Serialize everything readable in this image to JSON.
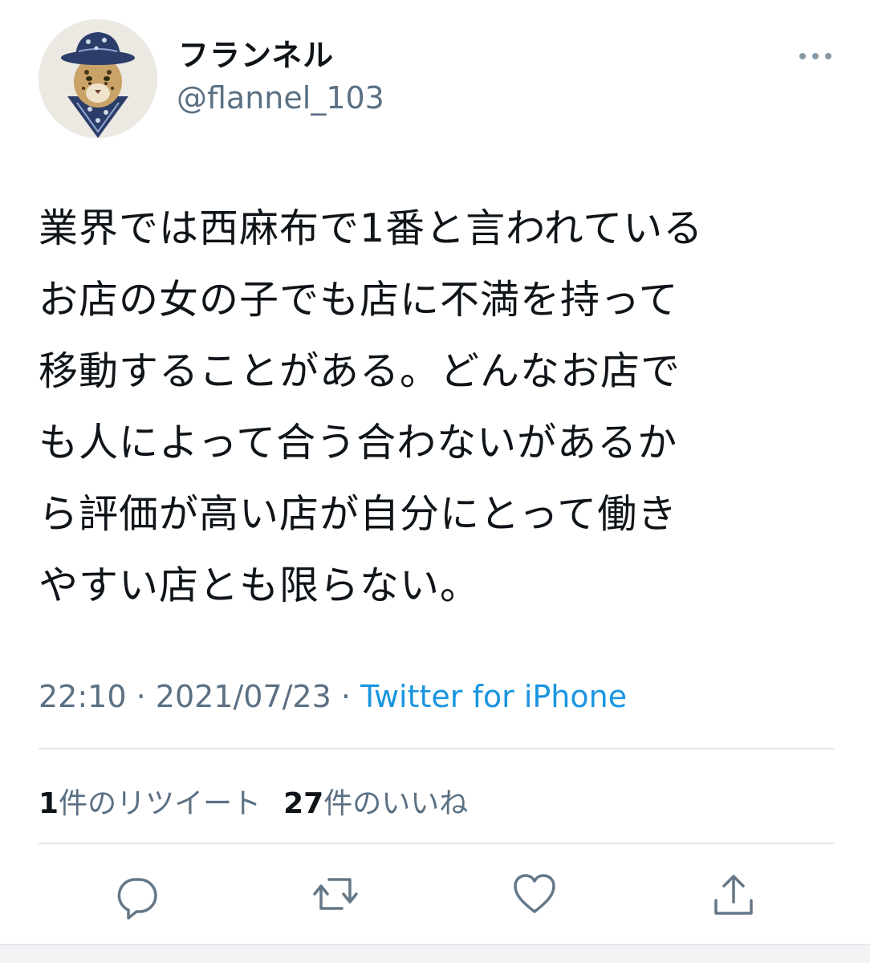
{
  "user": {
    "display_name": "フランネル",
    "handle": "@flannel_103",
    "avatar_icon": "leopard-avatar-icon"
  },
  "tweet": {
    "lines": [
      "業界では西麻布で1番と言われている",
      "お店の女の子でも店に不満を持って",
      "移動することがある。どんなお店で",
      "も人によって合う合わないがあるか",
      "ら評価が高い店が自分にとって働き",
      "やすい店とも限らない。"
    ]
  },
  "meta": {
    "time": "22:10",
    "separator": " · ",
    "date": "2021/07/23",
    "source": "Twitter for iPhone"
  },
  "stats": {
    "retweets": {
      "count": "1",
      "label": "件のリツイート"
    },
    "likes": {
      "count": "27",
      "label": "件のいいね"
    }
  },
  "actions": {
    "more_icon": "more-horizontal-icon",
    "reply_icon": "reply-icon",
    "retweet_icon": "retweet-icon",
    "like_icon": "heart-icon",
    "share_icon": "share-icon"
  },
  "colors": {
    "text": "#0f1419",
    "secondary": "#5b7083",
    "link": "#1b95e0",
    "divider": "#e1e8ed"
  }
}
